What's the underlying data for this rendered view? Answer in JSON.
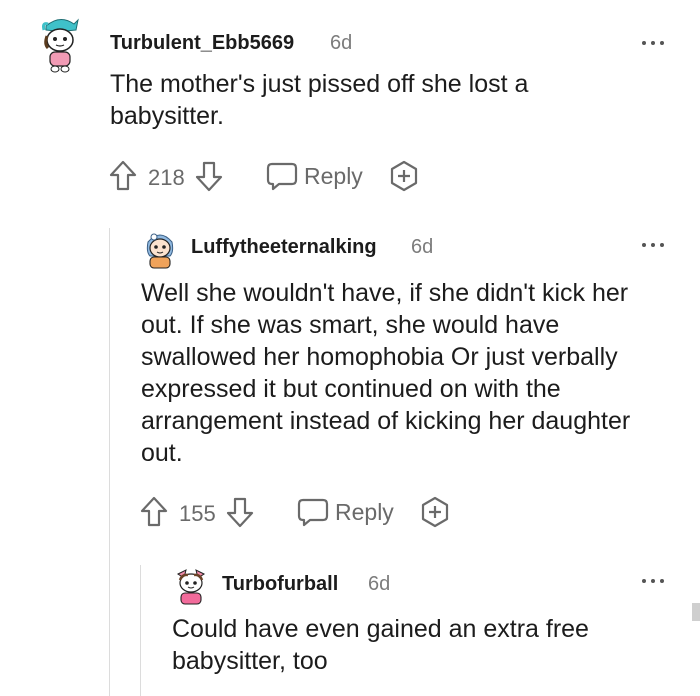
{
  "comments": [
    {
      "username": "Turbulent_Ebb5669",
      "age": "6d",
      "body": "The mother's just pissed off she lost a babysitter.",
      "upvotes": "218",
      "reply_label": "Reply",
      "avatar": "snoo-teal-hat-avatar"
    },
    {
      "username": "Luffytheeternalking",
      "age": "6d",
      "body": "Well she wouldn't have, if she didn't kick her out. If she was smart, she would have swallowed her homophobia Or just verbally expressed it but continued on with the arrangement instead of kicking her daughter out.",
      "upvotes": "155",
      "reply_label": "Reply",
      "avatar": "snoo-blue-hair-avatar"
    },
    {
      "username": "Turbofurball",
      "age": "6d",
      "body": "Could have even gained an extra free babysitter, too",
      "avatar": "snoo-pink-bow-avatar"
    }
  ],
  "icons": {
    "upvote": "upvote-arrow-icon",
    "downvote": "downvote-arrow-icon",
    "reply": "speech-bubble-icon",
    "award": "plus-award-icon",
    "more": "more-options-icon"
  },
  "colors": {
    "text": "#1c1c1c",
    "meta": "#7c7c7c",
    "icon": "#6a6a6a",
    "thread_line": "#dcdcdc"
  }
}
